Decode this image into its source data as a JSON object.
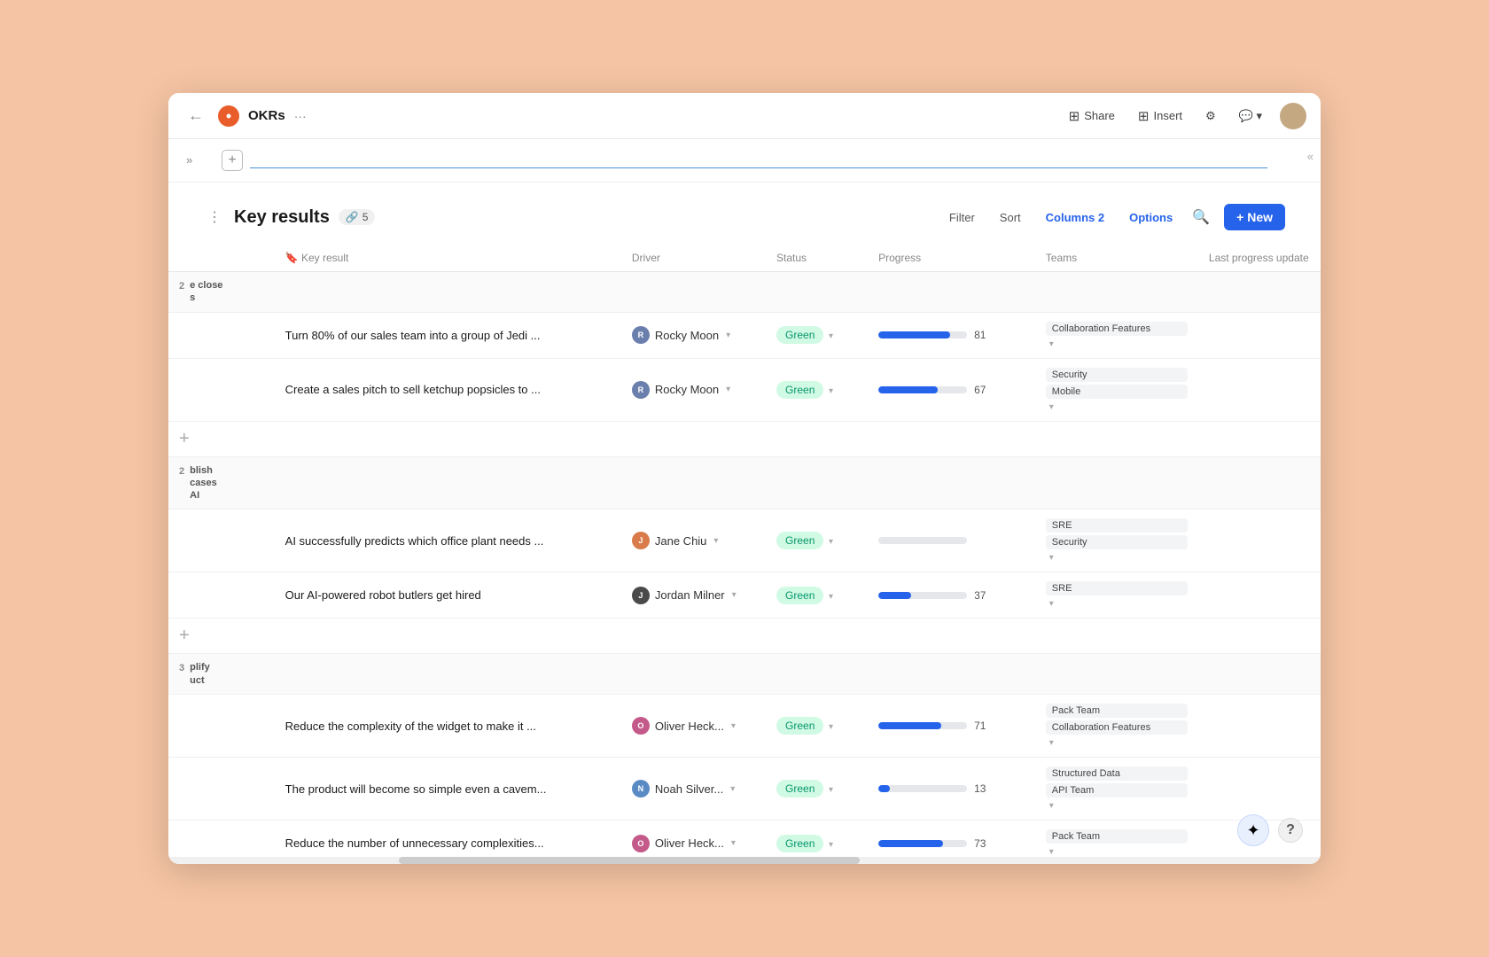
{
  "app": {
    "title": "OKRs",
    "dots": "···",
    "back_label": "←",
    "icon_letter": "O"
  },
  "toolbar": {
    "share_label": "Share",
    "insert_label": "Insert",
    "settings_icon": "⚙",
    "comment_icon": "💬",
    "expand_icon": "⌃"
  },
  "page": {
    "new_item_placeholder": ""
  },
  "key_results": {
    "title": "Key results",
    "link_count": "5",
    "filter_label": "Filter",
    "sort_label": "Sort",
    "columns_label": "Columns 2",
    "options_label": "Options",
    "new_label": "+ New"
  },
  "table": {
    "headers": {
      "key_result": "Key result",
      "driver": "Driver",
      "status": "Status",
      "progress": "Progress",
      "teams": "Teams",
      "last_update": "Last progress update"
    },
    "groups": [
      {
        "id": "group1",
        "label_line1": "e close",
        "label_line2": "s",
        "number": "2",
        "rows": [
          {
            "id": "kr1",
            "name": "Turn 80% of our sales team into a group of Jedi ...",
            "driver_name": "Rocky Moon",
            "driver_color": "#6b7fad",
            "status": "Green",
            "progress": 81,
            "teams": [
              "Collaboration Features"
            ]
          },
          {
            "id": "kr2",
            "name": "Create a sales pitch to sell ketchup popsicles to ...",
            "driver_name": "Rocky Moon",
            "driver_color": "#6b7fad",
            "status": "Green",
            "progress": 67,
            "teams": [
              "Security",
              "Mobile"
            ]
          }
        ]
      },
      {
        "id": "group2",
        "label_line1": "blish",
        "label_line2": "cases",
        "label_line3": "AI",
        "number": "2",
        "rows": [
          {
            "id": "kr3",
            "name": "AI successfully predicts which office plant needs ...",
            "driver_name": "Jane Chiu",
            "driver_color": "#d97b4a",
            "status": "Green",
            "progress": 0,
            "teams": [
              "SRE",
              "Security"
            ]
          },
          {
            "id": "kr4",
            "name": "Our AI-powered robot butlers get hired",
            "driver_name": "Jordan Milner",
            "driver_color": "#4a4a4a",
            "status": "Green",
            "progress": 37,
            "teams": [
              "SRE"
            ]
          }
        ]
      },
      {
        "id": "group3",
        "label_line1": "plify",
        "label_line2": "uct",
        "number": "3",
        "rows": [
          {
            "id": "kr5",
            "name": "Reduce the complexity of the widget to make it ...",
            "driver_name": "Oliver Heck...",
            "driver_color": "#c45a8a",
            "status": "Green",
            "progress": 71,
            "teams": [
              "Pack Team",
              "Collaboration Features"
            ]
          },
          {
            "id": "kr6",
            "name": "The product will become so simple even a cavem...",
            "driver_name": "Noah Silver...",
            "driver_color": "#5a8ac4",
            "status": "Green",
            "progress": 13,
            "teams": [
              "Structured Data",
              "API Team"
            ]
          },
          {
            "id": "kr7",
            "name": "Reduce the number of unnecessary complexities...",
            "driver_name": "Oliver Heck...",
            "driver_color": "#c45a8a",
            "status": "Green",
            "progress": 73,
            "teams": [
              "Pack Team"
            ]
          }
        ]
      }
    ]
  }
}
